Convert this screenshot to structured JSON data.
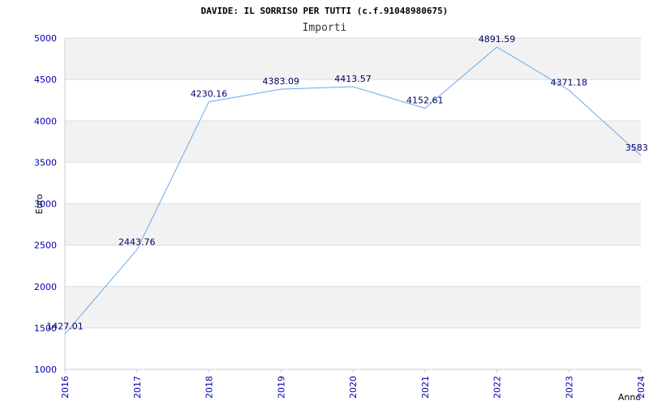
{
  "chart_data": {
    "type": "line",
    "title": "DAVIDE: IL SORRISO PER TUTTI (c.f.91048980675)",
    "subtitle": "Importi",
    "xlabel": "Anno",
    "ylabel": "Euro",
    "categories": [
      "2016",
      "2017",
      "2018",
      "2019",
      "2020",
      "2021",
      "2022",
      "2023",
      "2024"
    ],
    "series": [
      {
        "values": [
          1427.01,
          2443.76,
          4230.16,
          4383.09,
          4413.57,
          4152.61,
          4891.59,
          4371.18,
          3583.0
        ],
        "labels": [
          "1427.01",
          "2443.76",
          "4230.16",
          "4383.09",
          "4413.57",
          "4152.61",
          "4891.59",
          "4371.18",
          "3583.0"
        ]
      }
    ],
    "ylim": [
      1000,
      5000
    ],
    "yticks": [
      "1000",
      "1500",
      "2000",
      "2500",
      "3000",
      "3500",
      "4000",
      "4500",
      "5000"
    ],
    "grid": true,
    "colors": {
      "line": "#66aaee",
      "tick": "#0000aa",
      "band": "#f2f2f2"
    }
  }
}
